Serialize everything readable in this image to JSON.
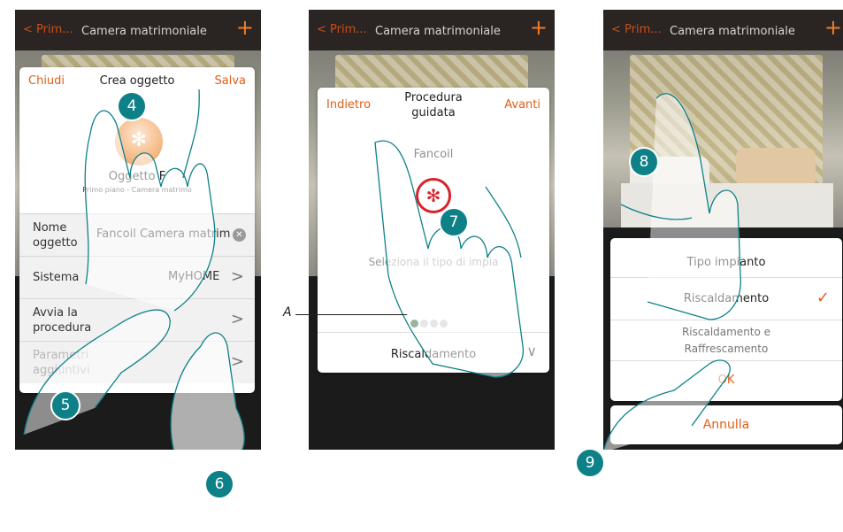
{
  "screen1": {
    "topbar": {
      "back": "< Prim...",
      "title": "Camera matrimoniale",
      "plus": "+"
    },
    "card": {
      "close": "Chiudi",
      "title": "Crea oggetto",
      "save": "Salva",
      "object_name": "Oggetto F",
      "object_path": "Primo piano - Camera matrimo",
      "rows": [
        {
          "label": "Nome oggetto",
          "value": "Fancoil Camera matrim"
        },
        {
          "label": "Sistema",
          "value": "MyHOME"
        },
        {
          "label": "Avvia la procedura",
          "value": ""
        },
        {
          "label": "Parametri aggiuntivi",
          "value": ""
        }
      ]
    }
  },
  "screen2": {
    "topbar": {
      "back": "< Prim...",
      "title": "Camera matrimoniale",
      "plus": "+"
    },
    "card": {
      "back": "Indietro",
      "title": "Procedura guidata",
      "next": "Avanti",
      "type_label": "Fancoil",
      "hint": "Seleziona il tipo di impia",
      "selected": "Riscaldamento",
      "step_total": 4,
      "step_current": 1
    }
  },
  "screen3": {
    "topbar": {
      "back": "< Prim...",
      "title": "Camera matrimoniale",
      "plus": "+"
    },
    "dialog": {
      "title": "Tipo impianto",
      "options": [
        "Riscaldamento",
        "Riscaldamento e Raffrescamento"
      ],
      "selected_index": 0,
      "ok": "OK",
      "cancel": "Annulla"
    }
  },
  "annotations": {
    "steps": [
      "4",
      "5",
      "6",
      "7",
      "8",
      "9"
    ],
    "callout_label": "A"
  },
  "colors": {
    "accent": "#e35d13",
    "step_badge": "#0e8188",
    "fan_red": "#d8232a",
    "active_dot": "#1c5a27"
  }
}
